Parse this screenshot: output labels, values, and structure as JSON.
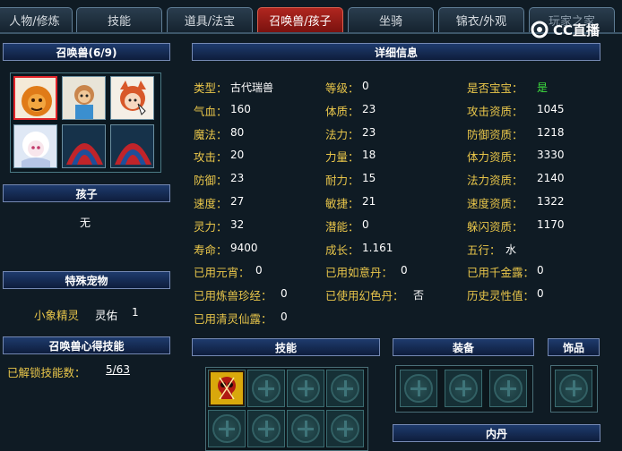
{
  "tabs": [
    "人物/修炼",
    "技能",
    "道具/法宝",
    "召唤兽/孩子",
    "坐骑",
    "锦衣/外观",
    "玩家之家"
  ],
  "watermark": "CC直播",
  "left": {
    "pets_title": "召唤兽(6/9)",
    "child_title": "孩子",
    "child_value": "无",
    "special_title": "特殊宠物",
    "special_name": "小象精灵",
    "special_label": "灵佑",
    "special_value": "1",
    "skill_title": "召唤兽心得技能",
    "unlocked_label": "已解锁技能数：",
    "unlocked_value": "5/63"
  },
  "detail": {
    "title": "详细信息",
    "rows": [
      [
        {
          "k": "类型：",
          "v": "古代瑞兽"
        },
        {
          "k": "等级：",
          "v": "0"
        },
        {
          "k": "是否宝宝：",
          "v": "是",
          "green": true
        }
      ],
      [
        {
          "k": "气血：",
          "v": "160"
        },
        {
          "k": "体质：",
          "v": "23"
        },
        {
          "k": "攻击资质：",
          "v": "1045"
        }
      ],
      [
        {
          "k": "魔法：",
          "v": "80"
        },
        {
          "k": "法力：",
          "v": "23"
        },
        {
          "k": "防御资质：",
          "v": "1218"
        }
      ],
      [
        {
          "k": "攻击：",
          "v": "20"
        },
        {
          "k": "力量：",
          "v": "18"
        },
        {
          "k": "体力资质：",
          "v": "3330"
        }
      ],
      [
        {
          "k": "防御：",
          "v": "23"
        },
        {
          "k": "耐力：",
          "v": "15"
        },
        {
          "k": "法力资质：",
          "v": "2140"
        }
      ],
      [
        {
          "k": "速度：",
          "v": "27"
        },
        {
          "k": "敏捷：",
          "v": "21"
        },
        {
          "k": "速度资质：",
          "v": "1322"
        }
      ],
      [
        {
          "k": "灵力：",
          "v": "32"
        },
        {
          "k": "潜能：",
          "v": "0"
        },
        {
          "k": "躲闪资质：",
          "v": "1170"
        }
      ],
      [
        {
          "k": "寿命：",
          "v": "9400"
        },
        {
          "k": "成长：",
          "v": "1.161"
        },
        {
          "k": "五行：",
          "v": "水"
        }
      ],
      [
        {
          "k": "已用元宵：",
          "v": "0"
        },
        {
          "k": "已用如意丹：",
          "v": "0"
        },
        {
          "k": "已用千金露：",
          "v": "0"
        }
      ],
      [
        {
          "k": "已用炼兽珍经：",
          "v": "0"
        },
        {
          "k": "已使用幻色丹：",
          "v": "否"
        },
        {
          "k": "历史灵性值：",
          "v": "0"
        }
      ],
      [
        {
          "k": "已用清灵仙露：",
          "v": "0"
        }
      ]
    ]
  },
  "bottom": {
    "skills_title": "技能",
    "equip_title": "装备",
    "ornament_title": "饰品",
    "neidan_title": "内丹"
  },
  "colors": {
    "label": "#e9c64a",
    "value": "#ffffff",
    "accent_green": "#3fe23f",
    "active_tab": "#b0261f"
  }
}
